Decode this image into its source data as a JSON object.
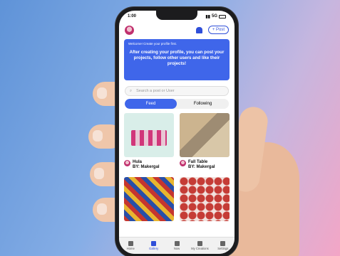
{
  "status": {
    "time": "1:00",
    "network": "5G"
  },
  "appbar": {
    "post_label": "+ Post"
  },
  "banner": {
    "small": "Welcome! Create your profile first.",
    "text": "After creating your profile, you can post your projects, follow other users and like their projects!"
  },
  "search": {
    "placeholder": "Search a post or User"
  },
  "segments": {
    "feed": "Feed",
    "following": "Following"
  },
  "cards": [
    {
      "title": "Hula",
      "by": "BY: Makergal"
    },
    {
      "title": "Fall Table",
      "by": "BY: Makergal"
    }
  ],
  "tabs": [
    "Home",
    "Gallery",
    "Now",
    "My Creations",
    "Settings"
  ],
  "colors": {
    "accent": "#3f66ea",
    "text": "#111111"
  }
}
